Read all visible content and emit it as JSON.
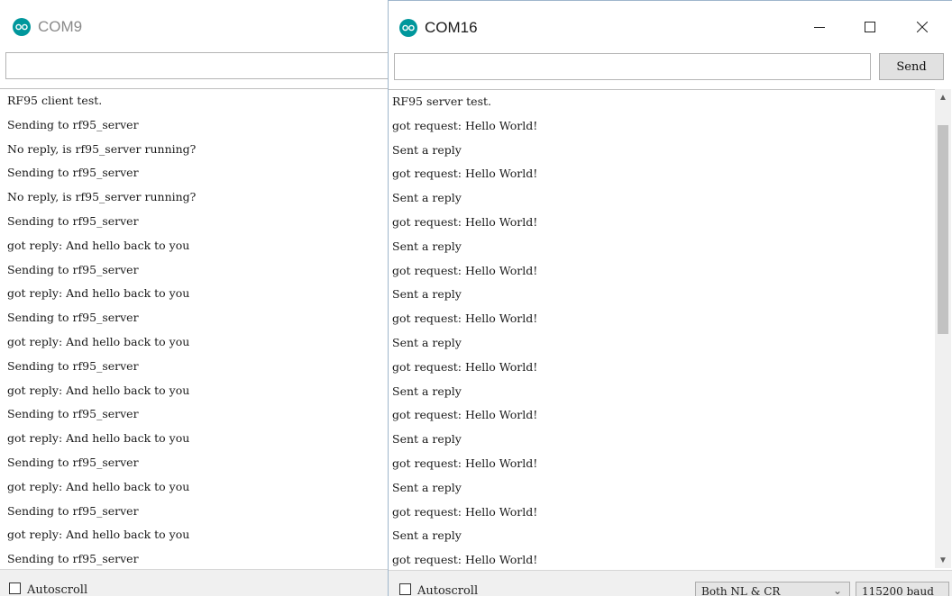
{
  "windows": {
    "com9": {
      "title": "COM9",
      "input_value": "",
      "lines": [
        "RF95 client test.",
        "Sending to rf95_server",
        "No reply, is rf95_server running?",
        "Sending to rf95_server",
        "No reply, is rf95_server running?",
        "Sending to rf95_server",
        "got reply: And hello back to you",
        "Sending to rf95_server",
        "got reply: And hello back to you",
        "Sending to rf95_server",
        "got reply: And hello back to you",
        "Sending to rf95_server",
        "got reply: And hello back to you",
        "Sending to rf95_server",
        "got reply: And hello back to you",
        "Sending to rf95_server",
        "got reply: And hello back to you",
        "Sending to rf95_server",
        "got reply: And hello back to you",
        "Sending to rf95_server"
      ],
      "autoscroll_label": "Autoscroll"
    },
    "com16": {
      "title": "COM16",
      "input_value": "",
      "send_label": "Send",
      "lines": [
        "RF95 server test.",
        "got request: Hello World!",
        "Sent a reply",
        "got request: Hello World!",
        "Sent a reply",
        "got request: Hello World!",
        "Sent a reply",
        "got request: Hello World!",
        "Sent a reply",
        "got request: Hello World!",
        "Sent a reply",
        "got request: Hello World!",
        "Sent a reply",
        "got request: Hello World!",
        "Sent a reply",
        "got request: Hello World!",
        "Sent a reply",
        "got request: Hello World!",
        "Sent a reply",
        "got request: Hello World!"
      ],
      "autoscroll_label": "Autoscroll",
      "line_ending": "Both NL & CR",
      "baud": "115200 baud"
    }
  },
  "icons": {
    "app": "arduino-icon",
    "minimize": "minimize-icon",
    "maximize": "maximize-icon",
    "close": "close-icon",
    "scroll_up": "chevron-up-icon",
    "scroll_down": "chevron-down-icon",
    "dropdown": "chevron-down-icon"
  },
  "colors": {
    "arduino_teal": "#00979c",
    "active_border": "#9fb6cc"
  }
}
